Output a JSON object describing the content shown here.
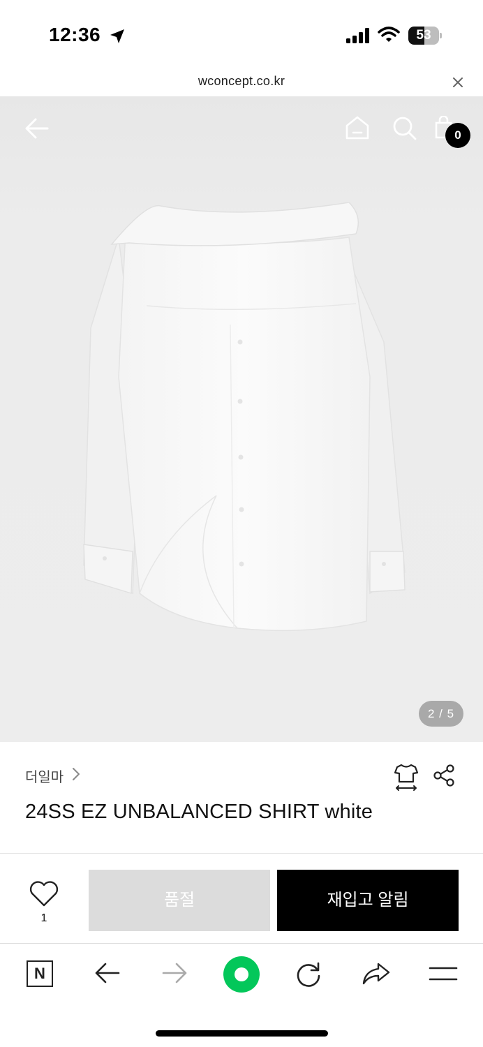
{
  "status_bar": {
    "time": "12:36",
    "battery_level": "53",
    "battery_fraction": 0.53,
    "icons": [
      "location-arrow-icon",
      "cellular-signal-icon",
      "wifi-icon",
      "battery-icon"
    ]
  },
  "browser": {
    "url": "wconcept.co.kr",
    "close_icon": "close-icon"
  },
  "hero": {
    "nav_icons": [
      "back-arrow-icon",
      "home-icon",
      "search-icon",
      "shopping-bag-icon"
    ],
    "cart_count": "0",
    "image_page": "2 / 5"
  },
  "product": {
    "brand": "더일마",
    "title": "24SS EZ UNBALANCED SHIRT white",
    "icons": [
      "size-guide-icon",
      "share-icon"
    ]
  },
  "actions": {
    "like_count": "1",
    "soldout_label": "품절",
    "restock_label": "재입고 알림"
  },
  "toolbar": {
    "n_label": "N",
    "icons": [
      "naver-n-icon",
      "back-arrow-icon",
      "forward-arrow-icon",
      "green-home-icon",
      "reload-icon",
      "share-arrow-icon",
      "menu-icon"
    ]
  },
  "colors": {
    "accent_green": "#03c75a",
    "soldout_bg": "#dcdcdc",
    "restock_bg": "#000000",
    "hero_bg": "#ededed"
  }
}
